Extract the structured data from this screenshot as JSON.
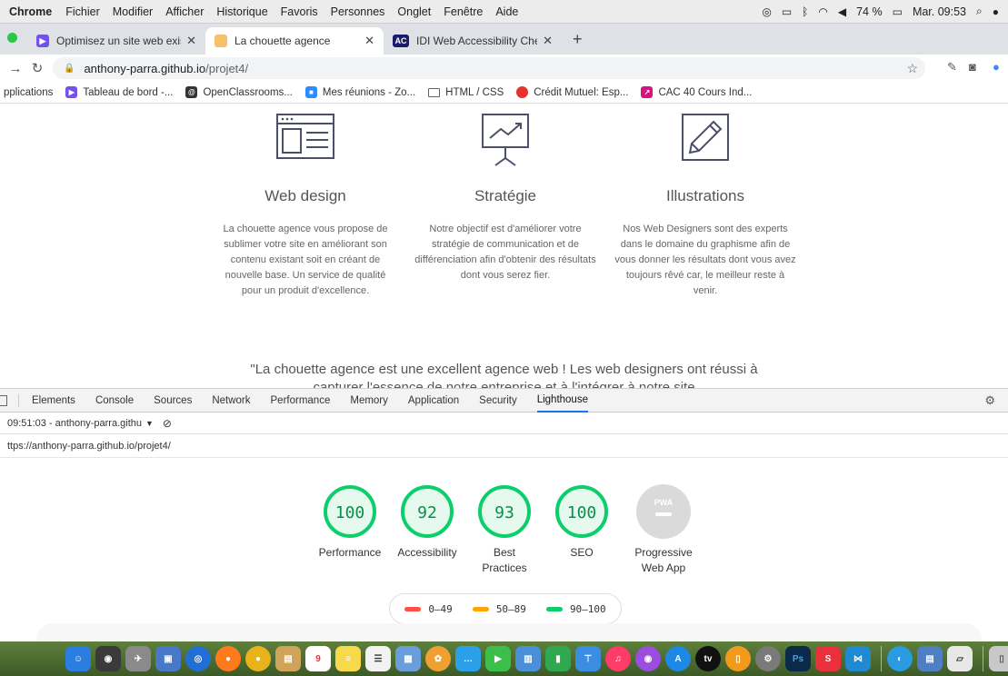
{
  "menubar": {
    "app": "Chrome",
    "items": [
      "Fichier",
      "Modifier",
      "Afficher",
      "Historique",
      "Favoris",
      "Personnes",
      "Onglet",
      "Fenêtre",
      "Aide"
    ],
    "battery": "74 %",
    "clock": "Mar. 09:53"
  },
  "tabs": [
    {
      "title": "Optimisez un site web existant",
      "favicon_color": "#7451eb",
      "icon": "openclassrooms-icon"
    },
    {
      "title": "La chouette agence",
      "favicon_color": "#f5c26b",
      "icon": "owl-icon"
    },
    {
      "title": "IDI Web Accessibility Checker",
      "favicon_color": "#1b1b6e",
      "icon": "ac-icon"
    }
  ],
  "address": {
    "host": "anthony-parra.github.io",
    "path": "/projet4/"
  },
  "bookmarks": [
    {
      "label": "pplications",
      "color": "#4285f4"
    },
    {
      "label": "Tableau de bord -...",
      "color": "#7451eb"
    },
    {
      "label": "OpenClassrooms...",
      "color": "#333333"
    },
    {
      "label": "Mes réunions - Zo...",
      "color": "#2d8cff"
    },
    {
      "label": "HTML / CSS",
      "color": "#5f6368"
    },
    {
      "label": "Crédit Mutuel: Esp...",
      "color": "#e5322d"
    },
    {
      "label": "CAC 40 Cours Ind...",
      "color": "#d6127f"
    }
  ],
  "page": {
    "services": [
      {
        "title": "Web design",
        "text": "La chouette agence vous propose de sublimer votre site en améliorant son contenu existant soit en créant de nouvelle base. Un service de qualité pour un produit d'excellence."
      },
      {
        "title": "Stratégie",
        "text": "Notre objectif est d'améliorer votre stratégie de communication et de différenciation afin d'obtenir des résultats dont vous serez fier."
      },
      {
        "title": "Illustrations",
        "text": "Nos Web Designers sont des experts dans le domaine du graphisme afin de vous donner les résultats dont vous avez toujours rêvé car, le meilleur reste à venir."
      }
    ],
    "quote_line1": "\"La chouette agence est une excellent agence web ! Les web designers ont réussi à",
    "quote_line2": "capturer l'essence de notre entreprise et à l'intégrer à notre site"
  },
  "devtools": {
    "tabs": [
      "Elements",
      "Console",
      "Sources",
      "Network",
      "Performance",
      "Memory",
      "Application",
      "Security",
      "Lighthouse"
    ],
    "selected_tab": "Lighthouse",
    "report_label": "09:51:03 - anthony-parra.githu",
    "url": "ttps://anthony-parra.github.io/projet4/",
    "scores": [
      {
        "value": 100,
        "label": "Performance"
      },
      {
        "value": 92,
        "label": "Accessibility"
      },
      {
        "value": 93,
        "label": "Best Practices"
      },
      {
        "value": 100,
        "label": "SEO"
      },
      {
        "value": null,
        "label": "Progressive Web App",
        "badge": "PWA"
      }
    ],
    "legend": [
      {
        "range": "0–49",
        "color": "#ff4e42"
      },
      {
        "range": "50–89",
        "color": "#ffa400"
      },
      {
        "range": "90–100",
        "color": "#0cce6b"
      }
    ]
  }
}
